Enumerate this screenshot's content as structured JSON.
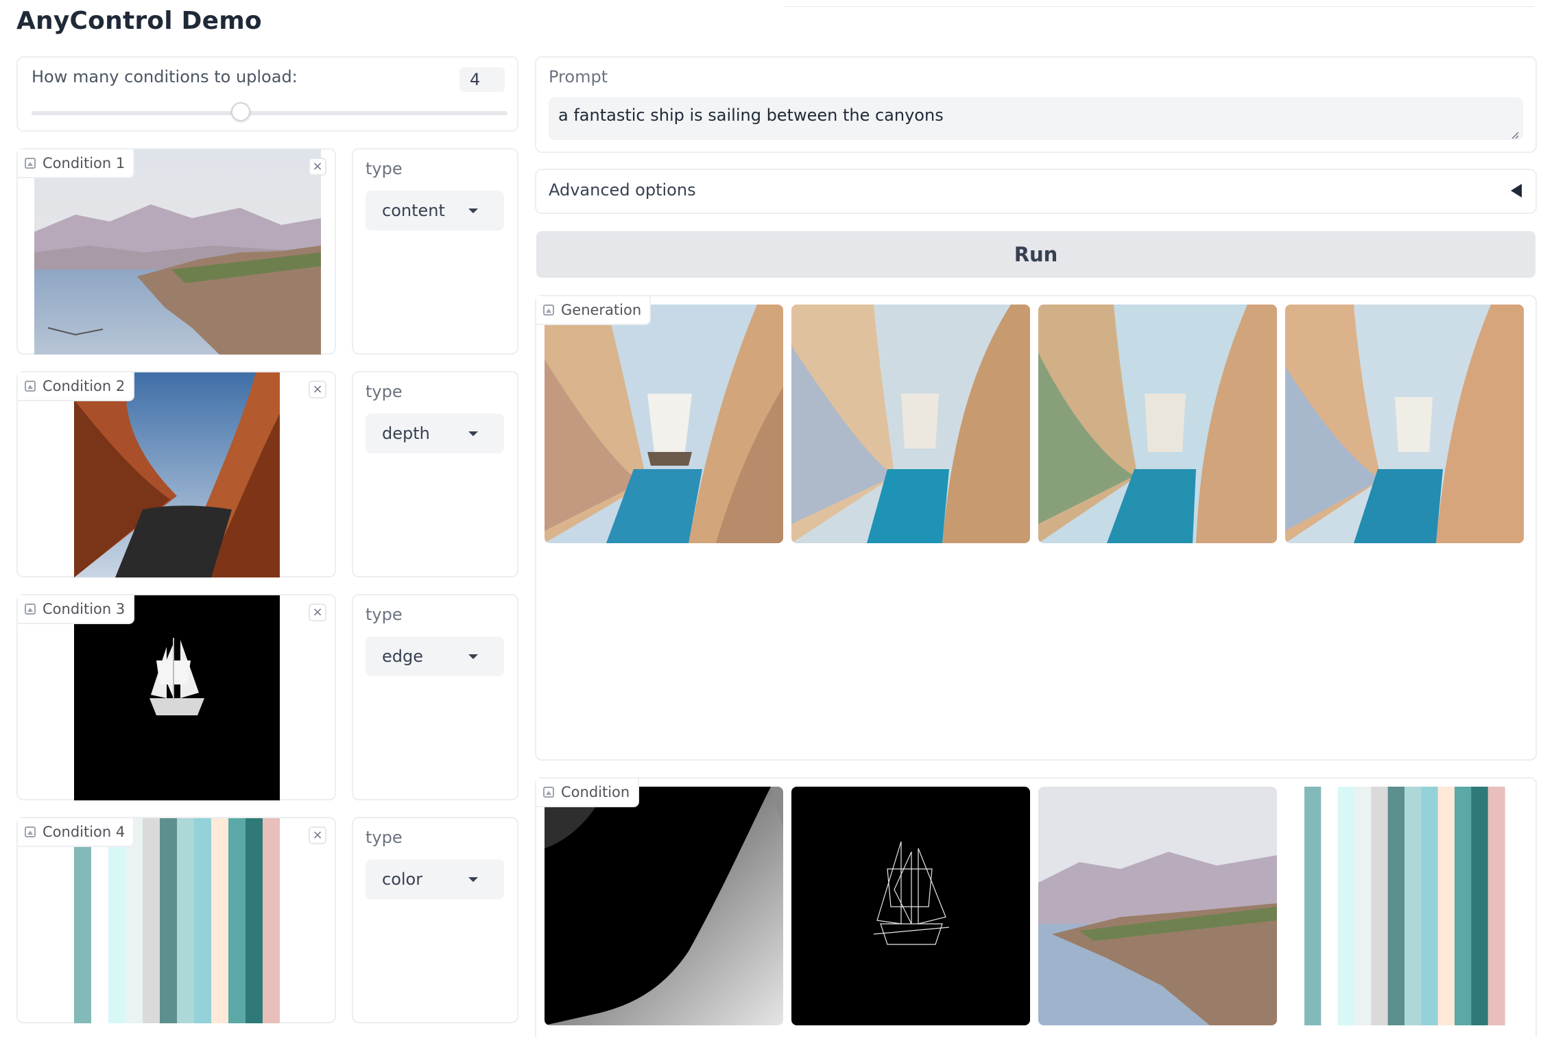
{
  "app": {
    "title": "AnyControl Demo"
  },
  "slider": {
    "label": "How many conditions to upload:",
    "value": "4",
    "fraction": 0.5
  },
  "conditions": [
    {
      "label": "Condition 1",
      "type_label": "type",
      "type_value": "content",
      "image": "cliffside-watercolor-landscape"
    },
    {
      "label": "Condition 2",
      "type_label": "type",
      "type_value": "depth",
      "image": "red-sandstone-canyon-photo"
    },
    {
      "label": "Condition 3",
      "type_label": "type",
      "type_value": "edge",
      "image": "white-sailing-ship-on-black"
    },
    {
      "label": "Condition 4",
      "type_label": "type",
      "type_value": "color",
      "image": "vertical-color-stripes"
    }
  ],
  "close_symbol": "×",
  "prompt": {
    "label": "Prompt",
    "value": "a fantastic ship is sailing between the canyons"
  },
  "advanced": {
    "label": "Advanced options"
  },
  "run": {
    "label": "Run"
  },
  "generation": {
    "label": "Generation",
    "images": [
      "generated-ship-in-canyon-1",
      "generated-ship-in-canyon-2",
      "generated-ship-in-canyon-3",
      "generated-ship-in-canyon-4"
    ]
  },
  "condition_gallery": {
    "label": "Condition",
    "images": [
      "depth-map",
      "edge-map-ship",
      "content-cliffside",
      "color-stripes"
    ]
  },
  "colors": {
    "stripes": [
      "#83b9b8",
      "#ffffff",
      "#d8f8f8",
      "#eaf2f2",
      "#dadada",
      "#5d8f8e",
      "#aed8d8",
      "#95d1d9",
      "#ffe9d8",
      "#5ba9a6",
      "#2f7a78",
      "#e8bfbb"
    ]
  }
}
